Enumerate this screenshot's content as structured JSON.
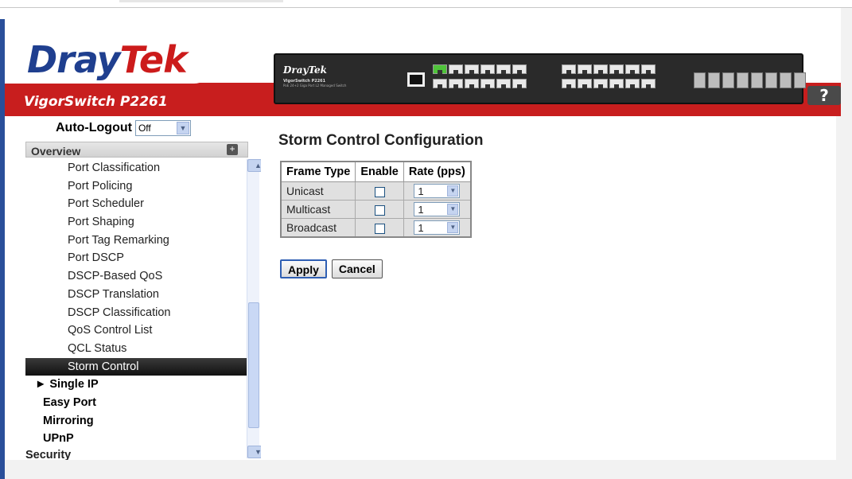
{
  "header": {
    "brand_part1": "Dray",
    "brand_part2": "Tek",
    "model": "VigorSwitch P2261",
    "device_brand": "DrayTek",
    "device_model": "VigorSwitch P2261",
    "device_sub": "PoE 24+2 Giga Port L2 Managed Switch",
    "help_label": "?"
  },
  "sidebar": {
    "auto_logout_label": "Auto-Logout",
    "auto_logout_value": "Off",
    "section_title": "Overview",
    "items": [
      {
        "label": "Port Classification"
      },
      {
        "label": "Port Policing"
      },
      {
        "label": "Port Scheduler"
      },
      {
        "label": "Port Shaping"
      },
      {
        "label": "Port Tag Remarking"
      },
      {
        "label": "Port DSCP"
      },
      {
        "label": "DSCP-Based QoS"
      },
      {
        "label": "DSCP Translation"
      },
      {
        "label": "DSCP Classification"
      },
      {
        "label": "QoS Control List"
      },
      {
        "label": "QCL Status"
      },
      {
        "label": "Storm Control"
      },
      {
        "label": "► Single IP"
      },
      {
        "label": "Easy Port"
      },
      {
        "label": "Mirroring"
      },
      {
        "label": "UPnP"
      },
      {
        "label": "Security"
      }
    ]
  },
  "main": {
    "title": "Storm Control Configuration",
    "columns": [
      "Frame Type",
      "Enable",
      "Rate (pps)"
    ],
    "rows": [
      {
        "frame_type": "Unicast",
        "enabled": false,
        "rate": "1"
      },
      {
        "frame_type": "Multicast",
        "enabled": false,
        "rate": "1"
      },
      {
        "frame_type": "Broadcast",
        "enabled": false,
        "rate": "1"
      }
    ],
    "apply_label": "Apply",
    "cancel_label": "Cancel"
  },
  "colors": {
    "brand_blue": "#1f3f8f",
    "brand_red": "#cc1b1b",
    "active_nav": "#111111",
    "table_cell": "#e0e0e0"
  }
}
